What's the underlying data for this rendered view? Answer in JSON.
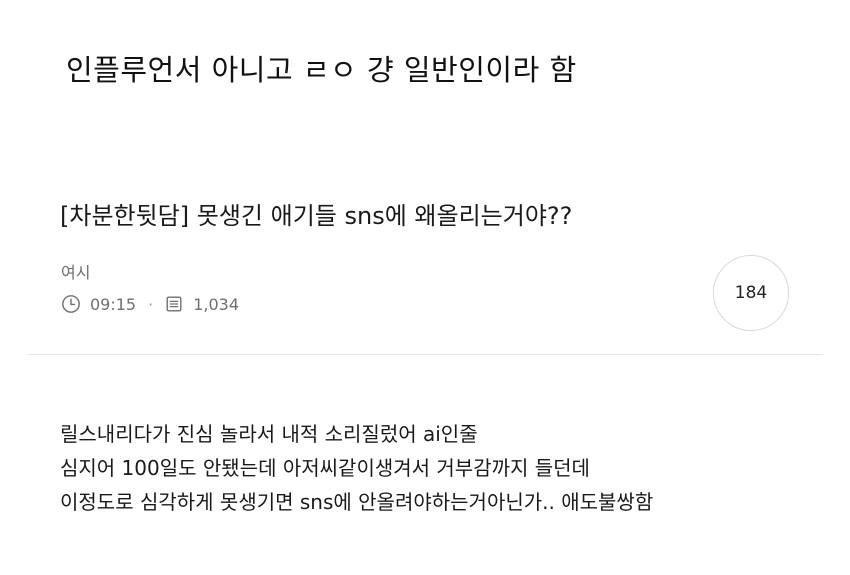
{
  "caption": "인플루언서 아니고 ㄹㅇ 걍 일반인이라 함",
  "post": {
    "title": "[차분한뒷담] 못생긴 애기들 sns에 왜올리는거야??",
    "author": "여시",
    "time": "09:15",
    "separator": "·",
    "views": "1,034",
    "comment_count": "184",
    "icons": {
      "time": "clock-icon",
      "views": "document-icon"
    },
    "body_lines": [
      "릴스내리다가 진심 놀라서 내적 소리질렀어 ai인줄",
      "심지어 100일도 안됐는데 아저씨같이생겨서 거부감까지 들던데",
      "이정도로 심각하게 못생기면 sns에 안올려야하는거아닌가.. 애도불쌍함"
    ]
  },
  "colors": {
    "text": "#1a1a1a",
    "meta": "#6f6f6f",
    "divider": "#e6e6e6",
    "badge_border": "#d9d9d9"
  }
}
